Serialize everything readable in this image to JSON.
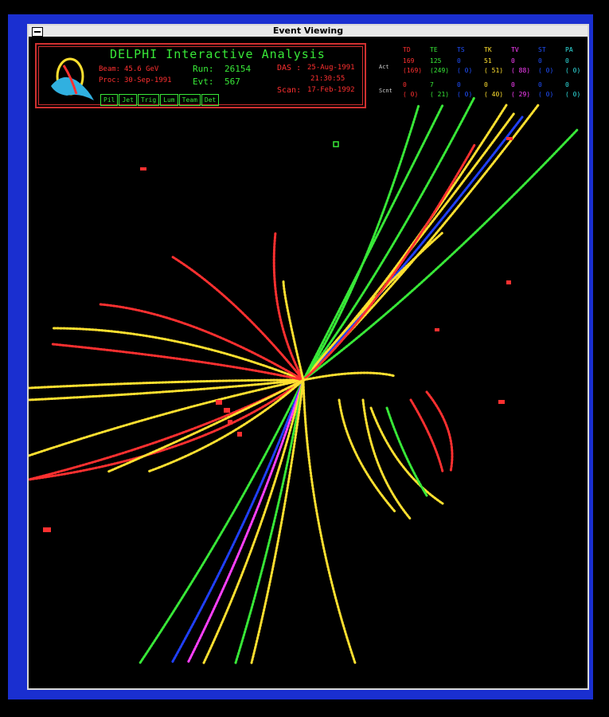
{
  "window": {
    "title": "Event Viewing"
  },
  "header": {
    "title": "DELPHI Interactive Analysis",
    "beam_label": "Beam:",
    "beam_value": "45.6 GeV",
    "proc_label": "Proc:",
    "proc_value": "30-Sep-1991",
    "run_label": "Run:",
    "run_value": "26154",
    "evt_label": "Evt:",
    "evt_value": "567",
    "das_label": "DAS :",
    "das_date": "25-Aug-1991",
    "das_time": "21:30:55",
    "scan_label": "Scan:",
    "scan_value": "17-Feb-1992",
    "tabs": [
      "Pil",
      "Jet",
      "Trig",
      "Lum",
      "Team",
      "Det"
    ]
  },
  "stats": {
    "columns": [
      {
        "name": "TD",
        "color": "#ff3030"
      },
      {
        "name": "TE",
        "color": "#38e838"
      },
      {
        "name": "TS",
        "color": "#2050ff"
      },
      {
        "name": "TK",
        "color": "#ffe030"
      },
      {
        "name": "TV",
        "color": "#ff40ff"
      },
      {
        "name": "ST",
        "color": "#2050ff"
      },
      {
        "name": "PA",
        "color": "#30e0e0"
      }
    ],
    "act_label": "Act",
    "act": [
      "169",
      "125",
      "0",
      "51",
      "0",
      "0",
      "0"
    ],
    "act_paren": [
      "(169)",
      "(249)",
      "(  0)",
      "( 51)",
      "( 88)",
      "(  0)",
      "(  0)"
    ],
    "scnt_label": "Scnt",
    "scnt": [
      "0",
      "7",
      "0",
      "0",
      "0",
      "0",
      "0"
    ],
    "scnt_paren": [
      "(  0)",
      "( 21)",
      "(  0)",
      "( 40)",
      "( 29)",
      "(  0)",
      "(  0)"
    ]
  },
  "colors": {
    "frame": "#1a2fd0",
    "red": "#ff3030",
    "yellow": "#ffe030",
    "green": "#38e838",
    "blue": "#2040ff",
    "magenta": "#ff40ff"
  }
}
